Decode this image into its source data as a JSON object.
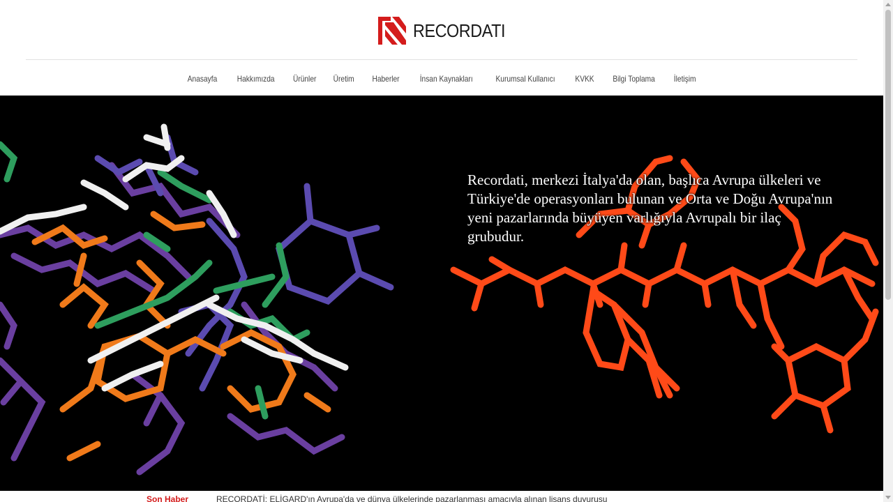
{
  "brand": {
    "name": "RECORDATI",
    "logo_color": "#d41c1c"
  },
  "nav": {
    "items": [
      "Anasayfa",
      "Hakkımızda",
      "Ürünler",
      "Üretim",
      "Haberler",
      "İnsan Kaynakları",
      "Kurumsal Kullanıcı",
      "KVKK",
      "Bilgi Toplama",
      "İletişim"
    ]
  },
  "hero": {
    "text": "Recordati, merkezi İtalya'da olan, başlıca Avrupa ülkeleri ve Türkiye'de operasyonları bulunan ve Orta ve Doğu Avrupa'nın yeni pazarlarında büyüyen varlığıyla Avrupalı bir ilaç grubudur.",
    "image": "molecular-structure-illustration",
    "background": "#000000",
    "molecule_colors": [
      "#6a3fa0",
      "#5b4bb0",
      "#f07a1a",
      "#2e9e5e",
      "#f0f0f0",
      "#ff4a18"
    ]
  },
  "ticker": {
    "label": "Son Haber",
    "text": "RECORDATİ: ELİGARD'ın Avrupa'da ve dünya ülkelerinde pazarlanması amacıyla alınan lisans duyurusu"
  },
  "icons": [
    "recordati-logo-icon",
    "scroll-up-icon",
    "scroll-down-icon"
  ]
}
